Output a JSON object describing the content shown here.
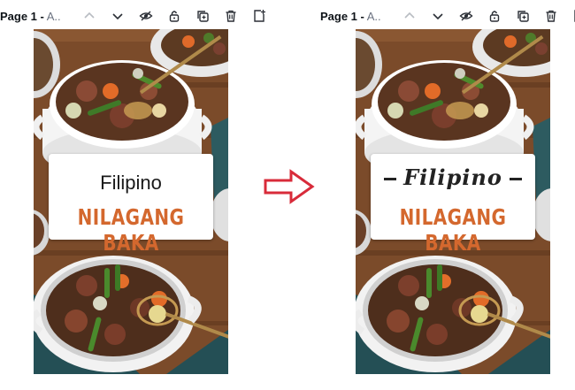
{
  "toolbar": {
    "page_label": "Page 1 -",
    "page_title_truncated": "A..",
    "icons": [
      "chevron-up-icon",
      "chevron-down-icon",
      "eye-hidden-icon",
      "lock-icon",
      "duplicate-icon",
      "trash-icon",
      "add-page-icon"
    ]
  },
  "before": {
    "card_line1": "Filipino",
    "card_line2": "NILAGANG BAKA"
  },
  "after": {
    "card_line1": "Filipino",
    "card_line2": "NILAGANG BAKA"
  },
  "colors": {
    "title_orange": "#d4682e",
    "arrow_red": "#d82b3a",
    "wood": "#7a4d2c",
    "teal_cloth": "#244f55"
  }
}
